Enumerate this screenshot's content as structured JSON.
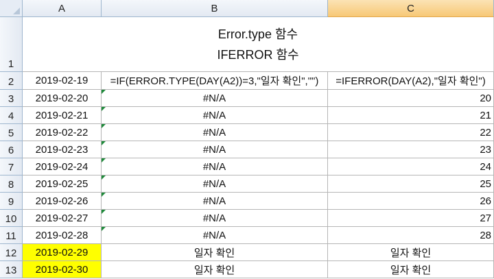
{
  "columns": [
    "A",
    "B",
    "C"
  ],
  "title": {
    "line1": "Error.type 함수",
    "line2": "IFERROR 함수"
  },
  "rows": [
    {
      "num": "1"
    },
    {
      "num": "2",
      "a": "2019-02-19",
      "b": "=IF(ERROR.TYPE(DAY(A2))=3,\"일자 확인\",\"\")",
      "c": "=IFERROR(DAY(A2),\"일자 확인\")"
    },
    {
      "num": "3",
      "a": "2019-02-20",
      "b": "#N/A",
      "c": "20"
    },
    {
      "num": "4",
      "a": "2019-02-21",
      "b": "#N/A",
      "c": "21"
    },
    {
      "num": "5",
      "a": "2019-02-22",
      "b": "#N/A",
      "c": "22"
    },
    {
      "num": "6",
      "a": "2019-02-23",
      "b": "#N/A",
      "c": "23"
    },
    {
      "num": "7",
      "a": "2019-02-24",
      "b": "#N/A",
      "c": "24"
    },
    {
      "num": "8",
      "a": "2019-02-25",
      "b": "#N/A",
      "c": "25"
    },
    {
      "num": "9",
      "a": "2019-02-26",
      "b": "#N/A",
      "c": "26"
    },
    {
      "num": "10",
      "a": "2019-02-27",
      "b": "#N/A",
      "c": "27"
    },
    {
      "num": "11",
      "a": "2019-02-28",
      "b": "#N/A",
      "c": "28"
    },
    {
      "num": "12",
      "a": "2019-02-29",
      "b": "일자 확인",
      "c": "일자 확인"
    },
    {
      "num": "13",
      "a": "2019-02-30",
      "b": "일자 확인",
      "c": "일자 확인"
    }
  ],
  "colors": {
    "highlight": "#ffff00",
    "selected_column": "#f7c876",
    "error_indicator": "#1e8a3a"
  }
}
